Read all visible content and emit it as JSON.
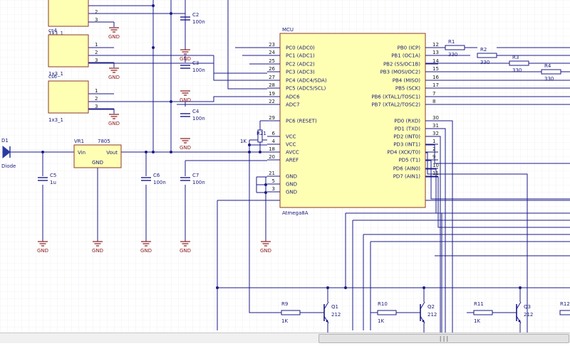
{
  "colors": {
    "wire": "#1a1a8a",
    "chip_fill": "#ffffb4",
    "chip_border": "#8b3a2a",
    "gnd_color": "#8b1a1a",
    "grid": "#e8e8ee",
    "diode_fill": "#2a3aa0"
  },
  "connectors": {
    "items": [
      {
        "name": "",
        "label": "1x3_1",
        "pins": [
          "",
          "2",
          "3"
        ],
        "gnd": "GND"
      },
      {
        "name": "cs4",
        "label": "1x3_1",
        "pins": [
          "1",
          "2",
          "3"
        ],
        "gnd": "GND"
      },
      {
        "name": "cs6",
        "label": "1x3_1",
        "pins": [
          "1",
          "2",
          "3"
        ],
        "gnd": "GND"
      }
    ]
  },
  "caps": {
    "c2": {
      "name": "C2",
      "value": "100n",
      "gnd": "GND"
    },
    "c3": {
      "name": "C3",
      "value": "100n",
      "gnd": "GND"
    },
    "c4": {
      "name": "C4",
      "value": "100n",
      "gnd": "GND"
    },
    "c5": {
      "name": "C5",
      "value": "1u",
      "gnd": "GND"
    },
    "c6": {
      "name": "C6",
      "value": "100n",
      "gnd": "GND"
    },
    "c7": {
      "name": "C7",
      "value": "100n",
      "gnd": "GND"
    }
  },
  "diode": {
    "name": "D1",
    "label": "Diode"
  },
  "regulator": {
    "name": "VR1",
    "part": "7805",
    "vin": "Vin",
    "vout": "Vout",
    "gnd": "GND",
    "gnd_sym": "GND"
  },
  "mcu": {
    "title": "MCU",
    "part": "Atmega8A",
    "left_pins": [
      {
        "num": "23",
        "label": "PC0 (ADC0)"
      },
      {
        "num": "24",
        "label": "PC1 (ADC1)"
      },
      {
        "num": "25",
        "label": "PC2 (ADC2)"
      },
      {
        "num": "26",
        "label": "PC3 (ADC3)"
      },
      {
        "num": "27",
        "label": "PC4 (ADC4/SDA)"
      },
      {
        "num": "28",
        "label": "PC5 (ADC5/SCL)"
      },
      {
        "num": "19",
        "label": "ADC6"
      },
      {
        "num": "22",
        "label": "ADC7"
      },
      {
        "num": "29",
        "label": "PC6 (RESET)"
      },
      {
        "num": "6",
        "label": "VCC"
      },
      {
        "num": "4",
        "label": "VCC"
      },
      {
        "num": "18",
        "label": "AVCC"
      },
      {
        "num": "20",
        "label": "AREF"
      },
      {
        "num": "21",
        "label": "GND"
      },
      {
        "num": "5",
        "label": "GND"
      },
      {
        "num": "3",
        "label": "GND"
      }
    ],
    "right_pins": [
      {
        "num": "12",
        "label": "PB0 (ICP)"
      },
      {
        "num": "13",
        "label": "PB1 (OC1A)"
      },
      {
        "num": "14",
        "label": "PB2 (SS/OC1B)"
      },
      {
        "num": "15",
        "label": "PB3 (MOSI/OC2)"
      },
      {
        "num": "16",
        "label": "PB4 (MISO)"
      },
      {
        "num": "17",
        "label": "PB5 (SCK)"
      },
      {
        "num": "7",
        "label": "PB6 (XTAL1/TOSC1)"
      },
      {
        "num": "8",
        "label": "PB7 (XTAL2/TOSC2)"
      },
      {
        "num": "30",
        "label": "PD0 (RXD)"
      },
      {
        "num": "31",
        "label": "PD1 (TXD)"
      },
      {
        "num": "32",
        "label": "PD2 (INT0)"
      },
      {
        "num": "1",
        "label": "PD3 (INT1)"
      },
      {
        "num": "2",
        "label": "PD4 (XCK/T0)"
      },
      {
        "num": "9",
        "label": "PD5 (T1)"
      },
      {
        "num": "10",
        "label": "PD6 (AIN0)"
      },
      {
        "num": "11",
        "label": "PD7 (AIN1)"
      }
    ],
    "gnd": "GND"
  },
  "reset_resistor": {
    "name": "R21",
    "value": "1K"
  },
  "resistors_top": [
    {
      "name": "R1",
      "value": "330"
    },
    {
      "name": "R2",
      "value": "330"
    },
    {
      "name": "R3",
      "value": "330"
    },
    {
      "name": "R4",
      "value": "330"
    }
  ],
  "transistor_stages": [
    {
      "res_name": "R9",
      "res_value": "1K",
      "q_name": "Q1",
      "q_part": "212"
    },
    {
      "res_name": "R10",
      "res_value": "1K",
      "q_name": "Q2",
      "q_part": "212"
    },
    {
      "res_name": "R11",
      "res_value": "1K",
      "q_name": "Q3",
      "q_part": "212"
    },
    {
      "res_name": "R12",
      "res_value": ""
    }
  ],
  "scrollbar": {
    "grip": "|||"
  }
}
